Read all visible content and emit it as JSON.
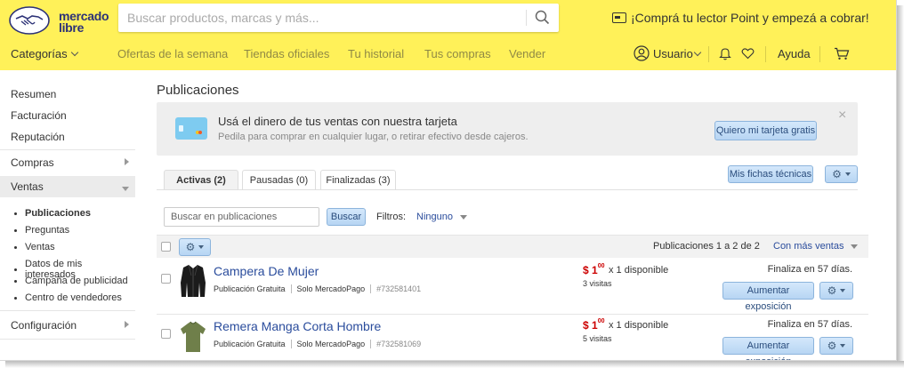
{
  "header": {
    "logo_text_line1": "mercado",
    "logo_text_line2": "libre",
    "search_placeholder": "Buscar productos, marcas y más...",
    "promo_text": "¡Comprá tu lector Point y empezá a cobrar!",
    "brand_color": "#fff159",
    "nav": {
      "categories": "Categorías",
      "links": [
        "Ofertas de la semana",
        "Tiendas oficiales",
        "Tu historial",
        "Tus compras",
        "Vender"
      ],
      "user": "Usuario",
      "help": "Ayuda"
    }
  },
  "sidebar": {
    "items": [
      "Resumen",
      "Facturación",
      "Reputación",
      "Compras",
      "Ventas"
    ],
    "sub_items": [
      "Publicaciones",
      "Preguntas",
      "Ventas",
      "Datos de mis interesados",
      "Campaña de publicidad",
      "Centro de vendedores"
    ],
    "config": "Configuración"
  },
  "main": {
    "title": "Publicaciones",
    "banner": {
      "title": "Usá el dinero de tus ventas con nuestra tarjeta",
      "subtitle": "Pedila para comprar en cualquier lugar, o retirar efectivo desde cajeros.",
      "button": "Quiero mi tarjeta gratis",
      "close": "×"
    },
    "tabs": [
      "Activas (2)",
      "Pausadas (0)",
      "Finalizadas (3)"
    ],
    "tech_sheets_button": "Mis fichas técnicas",
    "filter": {
      "placeholder": "Buscar en publicaciones",
      "button": "Buscar",
      "label": "Filtros:",
      "value": "Ninguno"
    },
    "list_header": {
      "count": "Publicaciones 1 a 2 de 2",
      "sort": "Con más ventas"
    },
    "items": [
      {
        "title": "Campera De Mujer",
        "type": "Publicación Gratuita",
        "payment": "Solo MercadoPago",
        "id": "#732581401",
        "price_symbol": "$",
        "price_int": "1",
        "price_dec": "00",
        "availability": "x 1 disponible",
        "visits": "3 visitas",
        "ends": "Finaliza en 57 días.",
        "action": "Aumentar exposición"
      },
      {
        "title": "Remera Manga Corta Hombre",
        "type": "Publicación Gratuita",
        "payment": "Solo MercadoPago",
        "id": "#732581069",
        "price_symbol": "$",
        "price_int": "1",
        "price_dec": "00",
        "availability": "x 1 disponible",
        "visits": "5 visitas",
        "ends": "Finaliza en 57 días.",
        "action": "Aumentar exposición"
      }
    ]
  }
}
